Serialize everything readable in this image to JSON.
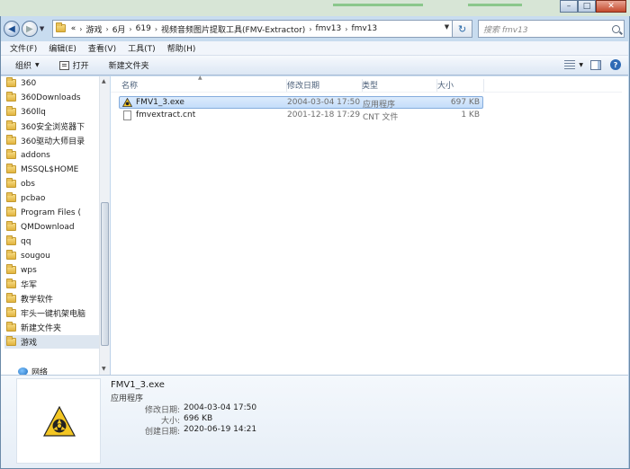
{
  "window": {
    "minimize_glyph": "–",
    "maximize_glyph": "□",
    "close_glyph": "✕"
  },
  "address": {
    "overflow_marker": "«",
    "crumbs": [
      "游戏",
      "6月",
      "619",
      "视频音频图片提取工具(FMV-Extractor)",
      "fmv13",
      "fmv13"
    ],
    "separator": "›"
  },
  "search": {
    "placeholder": "搜索 fmv13"
  },
  "menu": {
    "file": "文件(F)",
    "edit": "编辑(E)",
    "view": "查看(V)",
    "tools": "工具(T)",
    "help": "帮助(H)"
  },
  "toolbar": {
    "organize": "组织",
    "open": "打开",
    "new_folder": "新建文件夹"
  },
  "nav": {
    "items": [
      {
        "label": "360"
      },
      {
        "label": "360Downloads"
      },
      {
        "label": "360llq"
      },
      {
        "label": "360安全浏览器下"
      },
      {
        "label": "360驱动大师目录"
      },
      {
        "label": "addons"
      },
      {
        "label": "MSSQL$HOME"
      },
      {
        "label": "obs"
      },
      {
        "label": "pcbao"
      },
      {
        "label": "Program Files ("
      },
      {
        "label": "QMDownload"
      },
      {
        "label": "qq"
      },
      {
        "label": "sougou"
      },
      {
        "label": "wps"
      },
      {
        "label": "华军"
      },
      {
        "label": "教学软件"
      },
      {
        "label": "牢头一键机架电脑"
      },
      {
        "label": "新建文件夹"
      },
      {
        "label": "游戏"
      }
    ],
    "network": "网络"
  },
  "columns": {
    "name": "名称",
    "modified": "修改日期",
    "type": "类型",
    "size": "大小"
  },
  "files": [
    {
      "name": "FMV1_3.exe",
      "modified": "2004-03-04 17:50",
      "type": "应用程序",
      "size": "697 KB"
    },
    {
      "name": "fmvextract.cnt",
      "modified": "2001-12-18 17:29",
      "type": "CNT 文件",
      "size": "1 KB"
    }
  ],
  "details": {
    "title": "FMV1_3.exe",
    "type": "应用程序",
    "modified_label": "修改日期:",
    "modified_value": "2004-03-04 17:50",
    "size_label": "大小:",
    "size_value": "696 KB",
    "created_label": "创建日期:",
    "created_value": "2020-06-19 14:21"
  },
  "colors": {
    "selection": "#cfe3fb",
    "folder": "#e8c04c",
    "accent": "#2f6bb5"
  }
}
